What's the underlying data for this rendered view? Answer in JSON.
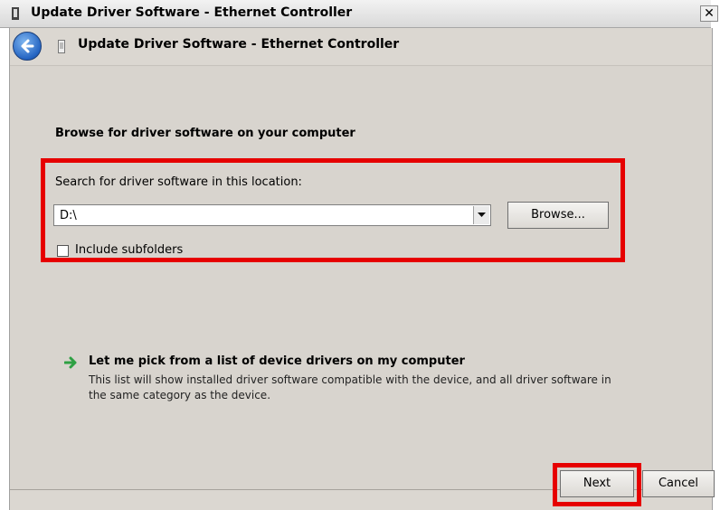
{
  "window": {
    "title": "Update Driver Software - Ethernet Controller",
    "close_glyph": "✕"
  },
  "header": {
    "title": "Update Driver Software - Ethernet Controller",
    "back_icon": "back-arrow-icon",
    "device_icon": "network-adapter-icon"
  },
  "main": {
    "section_title": "Browse for driver software on your computer",
    "search_label": "Search for driver software in this location:",
    "location_value": "D:\\",
    "browse_label": "Browse...",
    "include_subfolders_label": "Include subfolders",
    "include_subfolders_checked": false,
    "pick_link_title": "Let me pick from a list of device drivers on my computer",
    "pick_link_description": "This list will show installed driver software compatible with the device, and all driver software in the same category as the device."
  },
  "footer": {
    "next_label": "Next",
    "cancel_label": "Cancel"
  },
  "colors": {
    "highlight": "#e60000",
    "dialog_bg": "#d8d4ce",
    "link_arrow": "#2ea043"
  }
}
